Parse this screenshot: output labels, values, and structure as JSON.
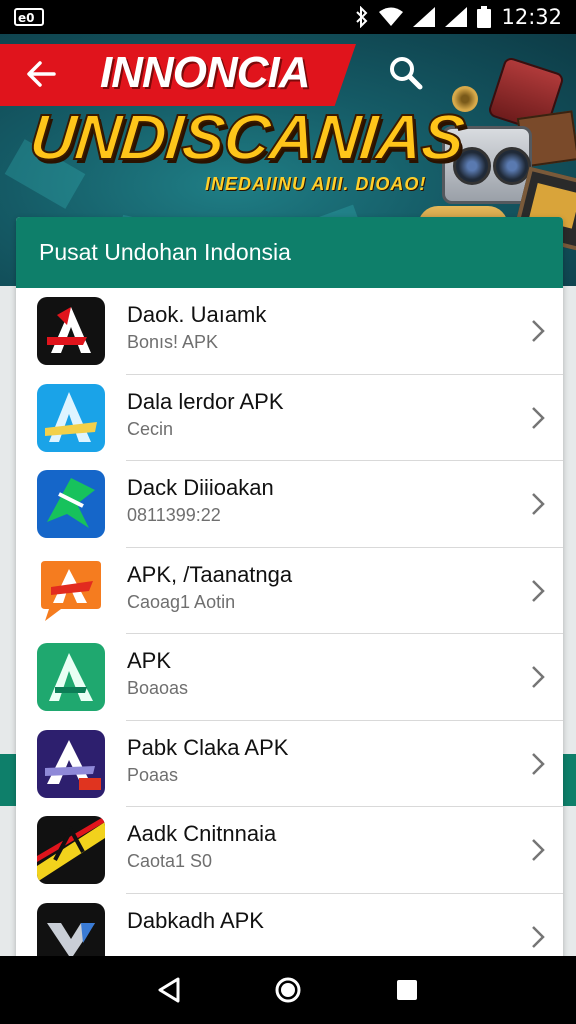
{
  "status_bar": {
    "left_icons": [
      "notification-icon"
    ],
    "right_icons": [
      "bluetooth-icon",
      "wifi-icon",
      "signal-icon",
      "signal-icon",
      "battery-icon"
    ],
    "time": "12:32"
  },
  "banner": {
    "title_top": "INNONCIA",
    "title_main": "UNDISCANIAS",
    "subtitle": "INEDAIINU AIII. DIOAO!",
    "back_icon": "back-arrow-icon",
    "search_icon": "search-icon",
    "colors": {
      "red": "#e0141c",
      "gold": "#ffc51a",
      "teal": "#155b66"
    }
  },
  "list_card": {
    "title": "Pusat Undohan Indonsia",
    "header_color": "#0e7f6a",
    "items": [
      {
        "name": "Daok. Uaıamk",
        "sub": "Bonıs! APK",
        "icon": "letter-a-red-icon",
        "colors": [
          "#111111",
          "#e0141c"
        ]
      },
      {
        "name": "Dala lerdor APK",
        "sub": "Cecin",
        "icon": "letter-a-blue-icon",
        "colors": [
          "#1aa3e8",
          "#f2d04a"
        ]
      },
      {
        "name": "Dack Diiioakan",
        "sub": "0811399:22",
        "icon": "green-star-icon",
        "colors": [
          "#1566c9",
          "#17c25c"
        ]
      },
      {
        "name": "APK, /Taanatnga",
        "sub": "Caoag1 Aotin",
        "icon": "orange-a-icon",
        "colors": [
          "#f57c1f",
          "#e22b1f"
        ]
      },
      {
        "name": "APK",
        "sub": "Boaoas",
        "icon": "letter-a-green-icon",
        "colors": [
          "#1fa86f",
          "#0c7d56"
        ]
      },
      {
        "name": "Pabk Claka APK",
        "sub": "Poaas",
        "icon": "letter-a-purple-icon",
        "colors": [
          "#2d1f6e",
          "#e0341f"
        ]
      },
      {
        "name": "Aadk Cnitnnaia",
        "sub": "Caota1 S0",
        "icon": "stripe-a-icon",
        "colors": [
          "#111111",
          "#f2d21c"
        ]
      },
      {
        "name": "Dabkadh APK",
        "sub": "",
        "icon": "chevron-v-icon",
        "colors": [
          "#111111",
          "#3a7bd5"
        ]
      }
    ]
  },
  "nav_bar": {
    "buttons": [
      "back-triangle-icon",
      "home-circle-icon",
      "recents-square-icon"
    ]
  }
}
